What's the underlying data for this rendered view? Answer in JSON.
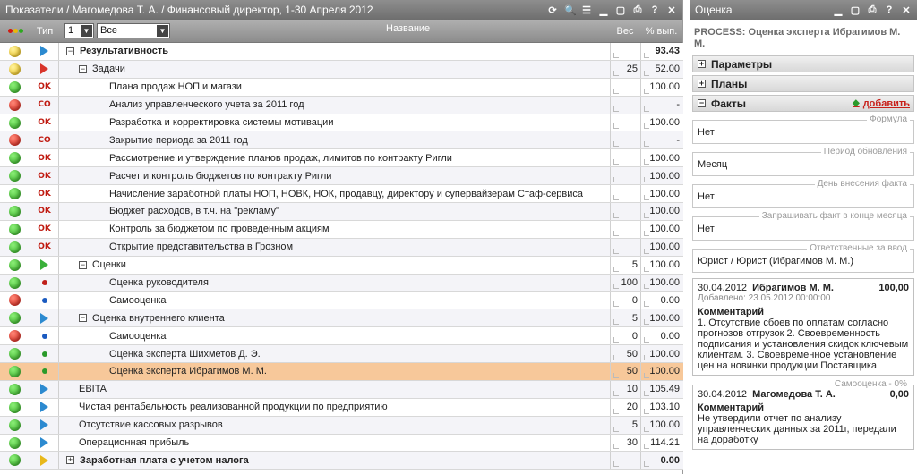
{
  "left": {
    "title": "Показатели / Магомедова Т. А. / Финансовый директор, 1-30 Апреля 2012",
    "tools": [
      "refresh-icon",
      "search-icon",
      "list-icon",
      "minimize-icon",
      "maximize-icon",
      "print-icon",
      "help-icon",
      "close-icon"
    ],
    "tool_glyphs": [
      "⟳",
      "🔍",
      "☰",
      "▁",
      "▢",
      "⎙",
      "?",
      "✕"
    ],
    "header": {
      "type": "Тип",
      "level_select": "1",
      "filter_select": "Все",
      "name": "Название",
      "weight": "Вес",
      "percent": "% вып."
    },
    "rows": [
      {
        "status": "yellow",
        "type": "tri-blue",
        "indent": 0,
        "exp": "−",
        "name": "Результативность",
        "bold": true,
        "weight": "",
        "percent": "93.43",
        "pbold": true
      },
      {
        "status": "yellow",
        "type": "tri-red",
        "indent": 1,
        "exp": "−",
        "name": "Задачи",
        "bold": false,
        "weight": "25",
        "percent": "52.00"
      },
      {
        "status": "green",
        "type": "ok",
        "indent": 2,
        "exp": "",
        "name": "Плана продаж НОП и магази",
        "weight": "",
        "percent": "100.00"
      },
      {
        "status": "red",
        "type": "co",
        "indent": 2,
        "exp": "",
        "name": "Анализ управленческого учета за 2011 год",
        "weight": "",
        "percent": "-"
      },
      {
        "status": "green",
        "type": "ok",
        "indent": 2,
        "exp": "",
        "name": "Разработка и корректировка системы мотивации",
        "weight": "",
        "percent": "100.00"
      },
      {
        "status": "red",
        "type": "co",
        "indent": 2,
        "exp": "",
        "name": "Закрытие периода за 2011 год",
        "weight": "",
        "percent": "-"
      },
      {
        "status": "green",
        "type": "ok",
        "indent": 2,
        "exp": "",
        "name": "Рассмотрение и утверждение планов продаж, лимитов по контракту Ригли",
        "weight": "",
        "percent": "100.00"
      },
      {
        "status": "green",
        "type": "ok",
        "indent": 2,
        "exp": "",
        "name": "Расчет и контроль бюджетов по контракту Ригли",
        "weight": "",
        "percent": "100.00"
      },
      {
        "status": "green",
        "type": "ok",
        "indent": 2,
        "exp": "",
        "name": "Начисление заработной платы НОП, НОВК, НОК, продавцу, директору и супервайзерам Стаф-сервиса",
        "weight": "",
        "percent": "100.00"
      },
      {
        "status": "green",
        "type": "ok",
        "indent": 2,
        "exp": "",
        "name": "Бюджет расходов, в т.ч. на \"рекламу\"",
        "weight": "",
        "percent": "100.00"
      },
      {
        "status": "green",
        "type": "ok",
        "indent": 2,
        "exp": "",
        "name": "Контроль за бюджетом по проведенным акциям",
        "weight": "",
        "percent": "100.00"
      },
      {
        "status": "green",
        "type": "ok",
        "indent": 2,
        "exp": "",
        "name": "Открытие представительства в Грозном",
        "weight": "",
        "percent": "100.00"
      },
      {
        "status": "green",
        "type": "tri-green",
        "indent": 1,
        "exp": "−",
        "name": "Оценки",
        "weight": "5",
        "percent": "100.00"
      },
      {
        "status": "green",
        "type": "dot-red",
        "indent": 2,
        "exp": "",
        "name": "Оценка руководителя",
        "weight": "100",
        "percent": "100.00"
      },
      {
        "status": "red",
        "type": "dot-blue",
        "indent": 2,
        "exp": "",
        "name": "Самооценка",
        "weight": "0",
        "percent": "0.00"
      },
      {
        "status": "green",
        "type": "tri-blue",
        "indent": 1,
        "exp": "−",
        "name": "Оценка внутреннего клиента",
        "weight": "5",
        "percent": "100.00"
      },
      {
        "status": "red",
        "type": "dot-blue",
        "indent": 2,
        "exp": "",
        "name": "Самооценка",
        "weight": "0",
        "percent": "0.00"
      },
      {
        "status": "green",
        "type": "dot-green",
        "indent": 2,
        "exp": "",
        "name": "Оценка эксперта Шихметов Д. Э.",
        "weight": "50",
        "percent": "100.00"
      },
      {
        "status": "green",
        "type": "dot-green",
        "indent": 2,
        "exp": "",
        "name": "Оценка эксперта Ибрагимов М. М.",
        "weight": "50",
        "percent": "100.00",
        "selected": true
      },
      {
        "status": "green",
        "type": "tri-blue",
        "indent": 1,
        "exp": "",
        "name": "EBITA",
        "weight": "10",
        "percent": "105.49"
      },
      {
        "status": "green",
        "type": "tri-blue",
        "indent": 1,
        "exp": "",
        "name": "Чистая рентабельность реализованной продукции по предприятию",
        "weight": "20",
        "percent": "103.10"
      },
      {
        "status": "green",
        "type": "tri-blue",
        "indent": 1,
        "exp": "",
        "name": "Отсутствие кассовых разрывов",
        "weight": "5",
        "percent": "100.00"
      },
      {
        "status": "green",
        "type": "tri-blue",
        "indent": 1,
        "exp": "",
        "name": "Операционная прибыль",
        "weight": "30",
        "percent": "114.21"
      },
      {
        "status": "green",
        "type": "tri-yellow",
        "indent": 0,
        "exp": "+",
        "name": "Заработная плата с учетом налога",
        "bold": true,
        "weight": "",
        "percent": "0.00",
        "pbold": true
      }
    ],
    "badges": {
      "ok": "OK",
      "co": "CO"
    }
  },
  "right": {
    "title": "Оценка",
    "tools": [
      "minimize-icon",
      "maximize-icon",
      "print-icon",
      "help-icon",
      "close-icon"
    ],
    "tool_glyphs": [
      "▁",
      "▢",
      "⎙",
      "?",
      "✕"
    ],
    "process": "PROCESS: Оценка эксперта Ибрагимов М. М.",
    "sections": {
      "params": "Параметры",
      "plans": "Планы",
      "facts": "Факты",
      "add": "добавить"
    },
    "fields": [
      {
        "label": "Формула",
        "value": "Нет"
      },
      {
        "label": "Период обновления",
        "value": "Месяц"
      },
      {
        "label": "День внесения факта",
        "value": "Нет"
      },
      {
        "label": "Запрашивать факт в конце месяца",
        "value": "Нет"
      },
      {
        "label": "Ответственные за ввод",
        "value": "Юрист / Юрист (Ибрагимов М. М.)"
      }
    ],
    "facts": [
      {
        "date": "30.04.2012",
        "name": "Ибрагимов М. М.",
        "value": "100,00",
        "added": "Добавлено: 23.05.2012 00:00:00",
        "comment_label": "Комментарий",
        "comment": "1. Отсутствие сбоев по оплатам согласно прогнозов отгрузок 2. Своевременность подписания и установления скидок ключевым клиентам. 3. Своевременное установление цен на новинки продукции Поставщика"
      },
      {
        "label": "Самооценка - 0%",
        "date": "30.04.2012",
        "name": "Магомедова Т. А.",
        "value": "0,00",
        "comment_label": "Комментарий",
        "comment": "Не утвердили отчет по анализу управленческих данных за 2011г, передали на доработку"
      }
    ]
  },
  "colors": {
    "green": "#2da81e",
    "red": "#d11a10",
    "yellow": "#e8b80a",
    "blue": "#2c8ad0",
    "selected": "#f7c89a"
  }
}
